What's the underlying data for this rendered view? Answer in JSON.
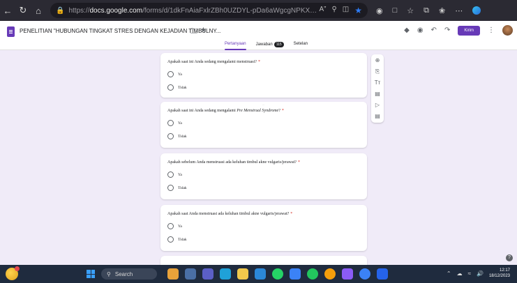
{
  "browser": {
    "url_host": "https://docs.google.com",
    "url_path": "/forms/d/1dkFnAiaFxlrZBh0UZDYL-pDa6aWgcgNPKXK93Pypw1Y...",
    "url_prefix": "https://",
    "url_domain": "docs.google.com",
    "url_rest": "/forms/d/1dkFnAiaFxlrZBh0UZDYL-pDa6aWgcgNPKXK93Pypw1Y..."
  },
  "form": {
    "title": "PENELITIAN \"HUBUNGAN TINGKAT STRES DENGAN KEJADIAN TIMBULNY...",
    "send_label": "Kirim",
    "tabs": [
      {
        "label": "Pertanyaan"
      },
      {
        "label": "Jawaban",
        "badge": "115"
      },
      {
        "label": "Setelan"
      }
    ]
  },
  "questions": [
    {
      "text": "Apakah saat ini Anda sedang mengalami menstruasi?",
      "italic": "",
      "suffix": "",
      "options": [
        "Ya",
        "Tidak"
      ]
    },
    {
      "text": "Apakah saat ini Anda sedang mengalami ",
      "italic": "Pre Menstrual Syndrome",
      "suffix": "?",
      "options": [
        "Ya",
        "Tidak"
      ]
    },
    {
      "text": "Apakah sebelum Anda menstruasi ada keluhan timbul akne vulgaris/jerawat?",
      "italic": "",
      "suffix": "",
      "options": [
        "Ya",
        "Tidak"
      ]
    },
    {
      "text": "Apakah saat Anda menstruasi ada keluhan timbul akne vulgaris/jerawat?",
      "italic": "",
      "suffix": "",
      "options": [
        "Ya",
        "Tidak"
      ]
    }
  ],
  "required_mark": "*",
  "taskbar": {
    "search_placeholder": "Search",
    "time": "12:17",
    "date": "18/12/2023"
  },
  "colors": {
    "accent": "#673ab7",
    "background": "#f0ebf8"
  }
}
